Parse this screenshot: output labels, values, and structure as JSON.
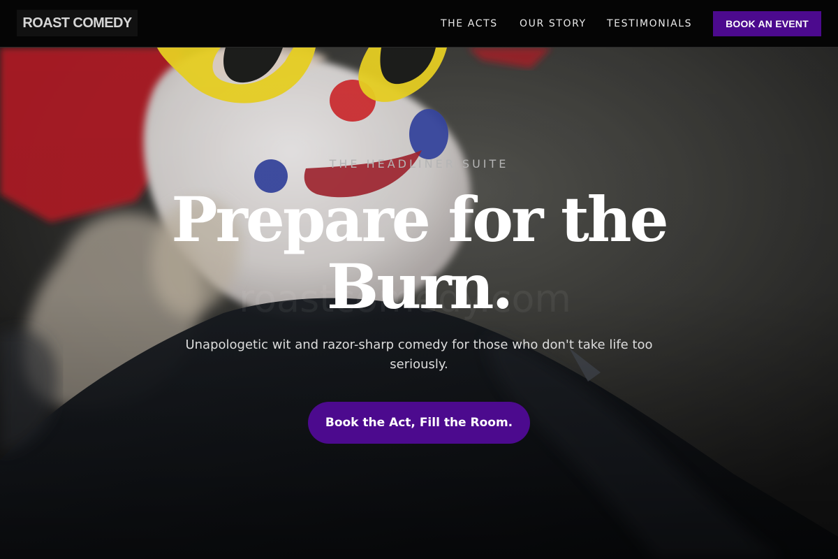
{
  "nav": {
    "logo": "ROAST COMEDY",
    "links": [
      "THE ACTS",
      "OUR STORY",
      "TESTIMONIALS"
    ],
    "cta": "BOOK AN EVENT"
  },
  "hero": {
    "eyebrow": "THE HEADLINER SUITE",
    "headline": "Prepare for the Burn.",
    "subtitle": "Unapologetic wit and razor-sharp comedy for those who don't take life too seriously.",
    "cta": "Book the Act, Fill the Room.",
    "watermark": "roastcomedy.com"
  },
  "colors": {
    "background": "#050505",
    "accent": "#4c0a8e",
    "text": "#ffffff",
    "muted_text": "#b5b5b5"
  }
}
